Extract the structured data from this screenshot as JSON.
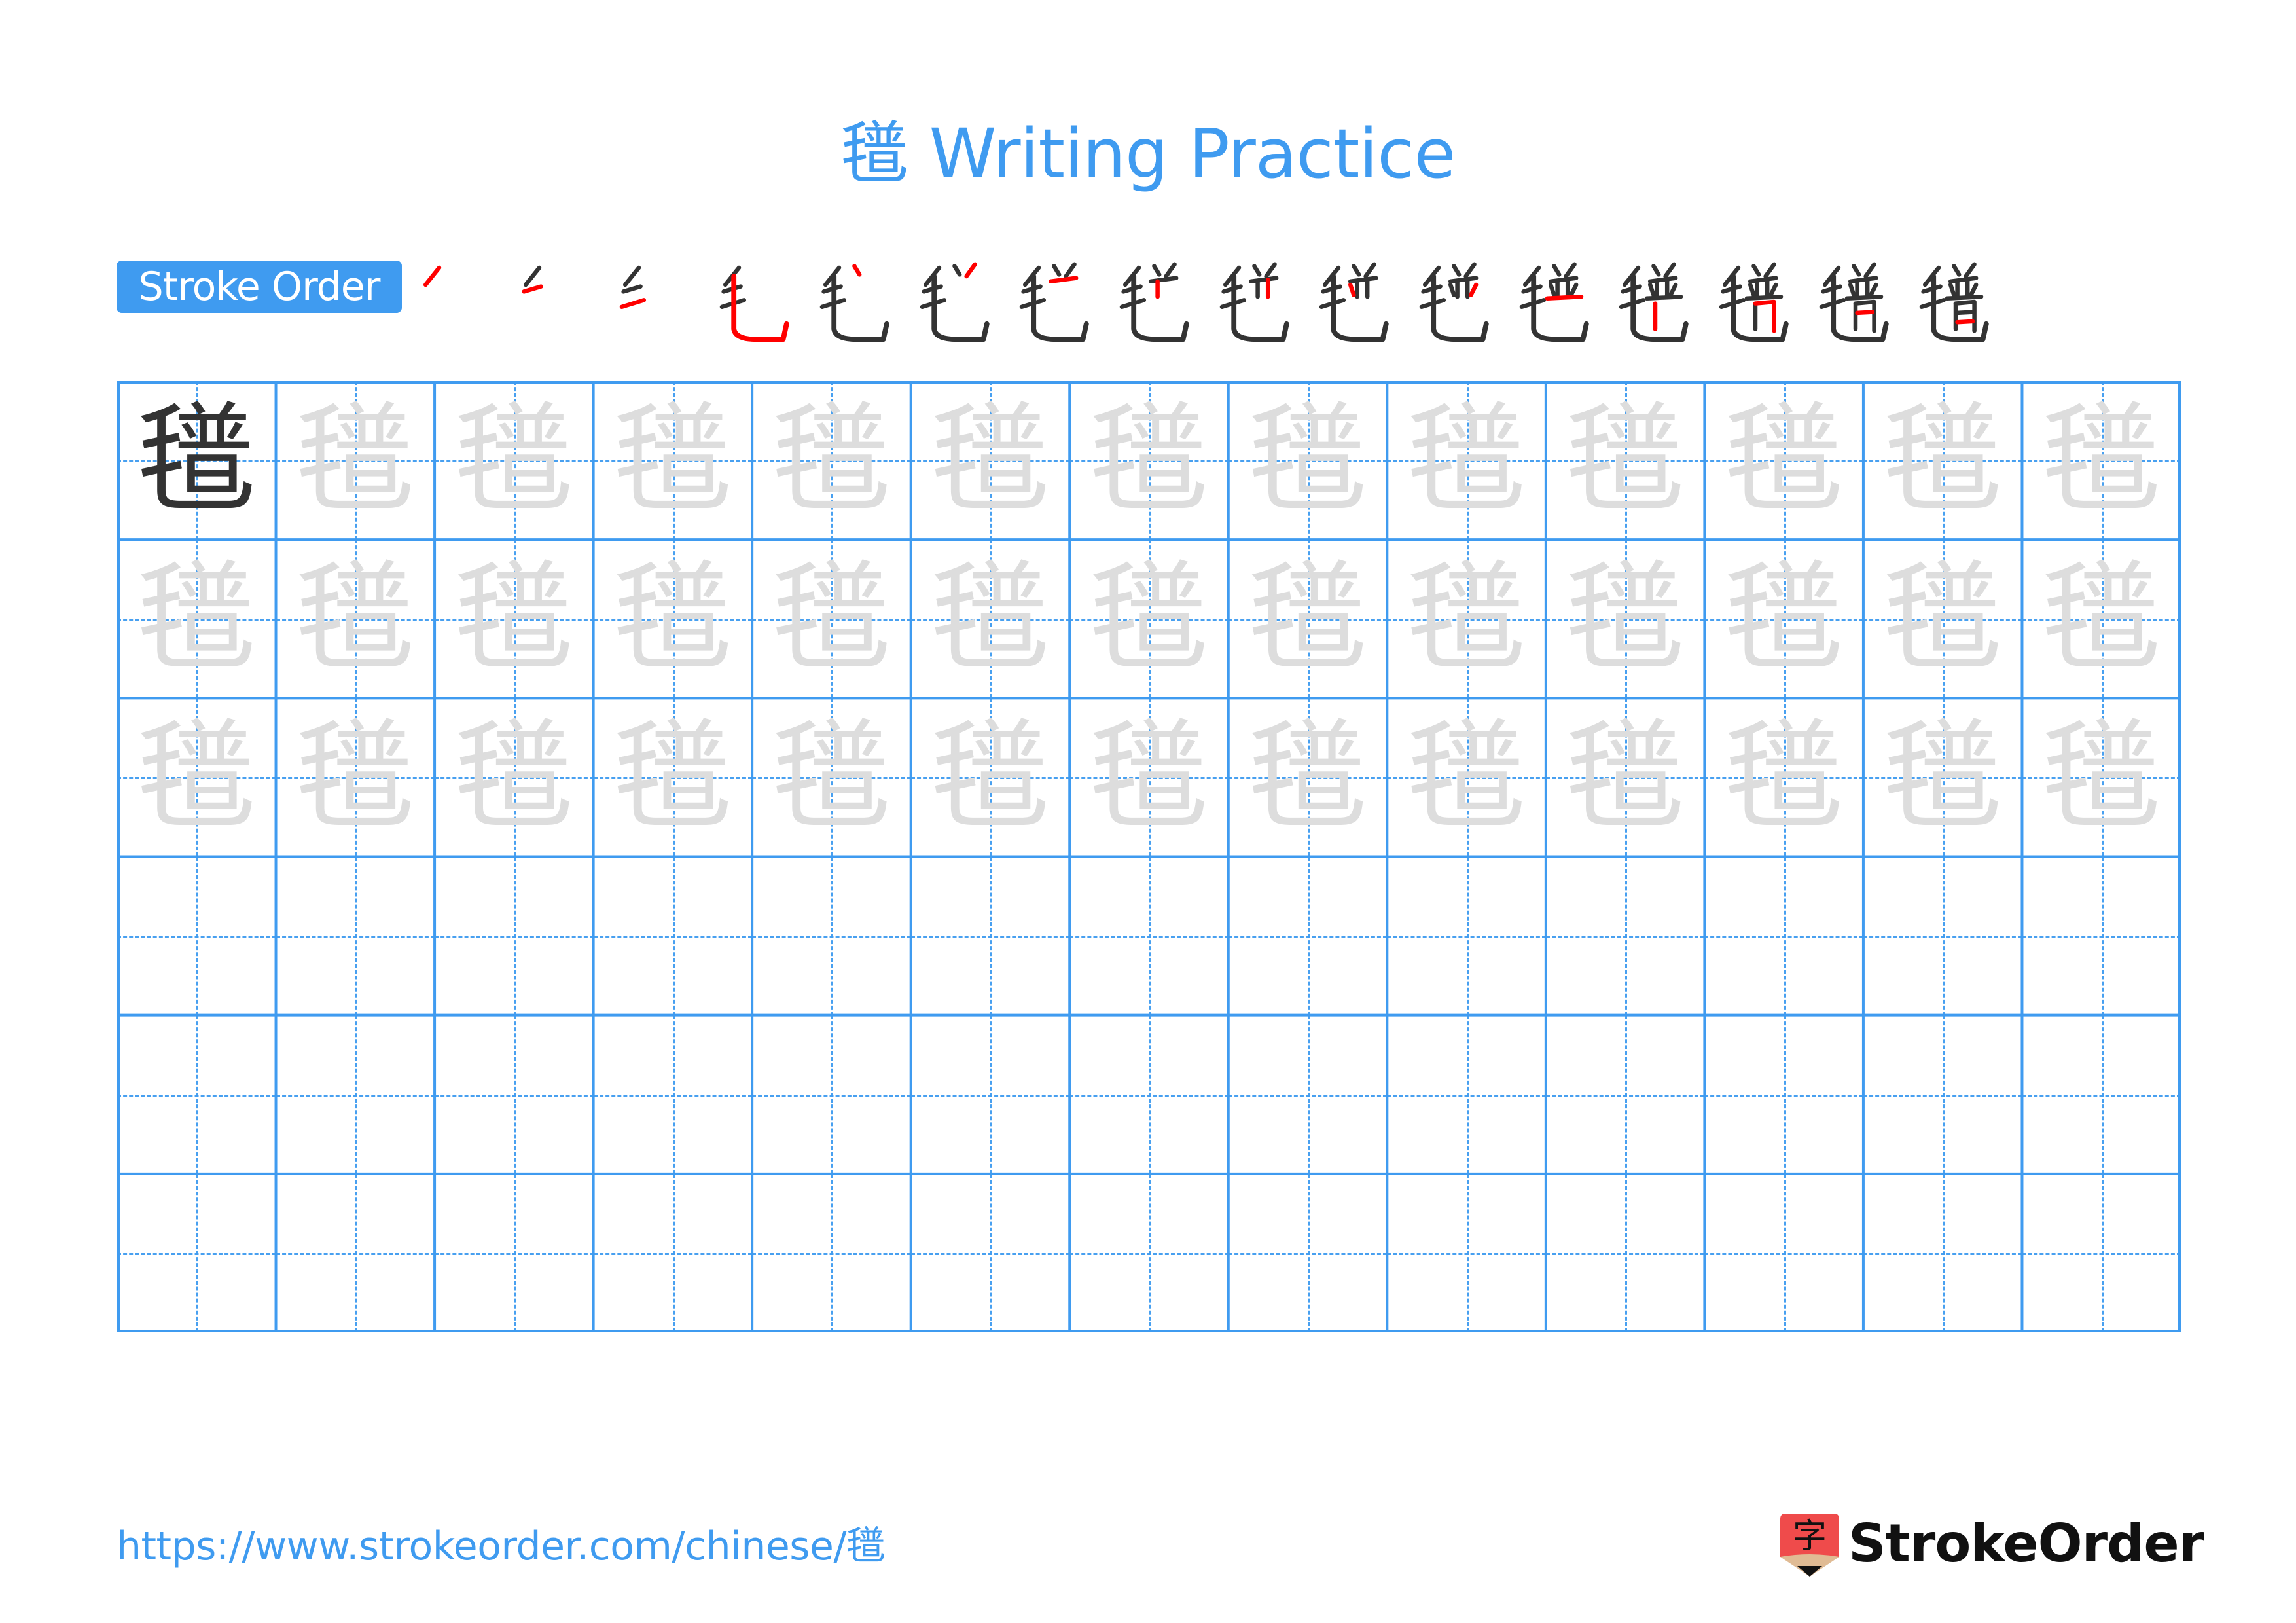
{
  "page": {
    "character": "氆",
    "title": "氆 Writing Practice",
    "stroke_order_label": "Stroke Order",
    "stroke_count": 16,
    "footer_url": "https://www.strokeorder.com/chinese/氆",
    "brand_name": "StrokeOrder",
    "brand_icon_glyph": "字"
  },
  "colors": {
    "accent": "#3f9bf0",
    "stroke_done": "#333333",
    "stroke_current": "#ff0000",
    "trace": "#dddddd",
    "brand_red": "#ef4b4b",
    "brand_wood": "#e0bb94"
  },
  "stroke_steps": [
    {
      "step": 1
    },
    {
      "step": 2
    },
    {
      "step": 3
    },
    {
      "step": 4
    },
    {
      "step": 5
    },
    {
      "step": 6
    },
    {
      "step": 7
    },
    {
      "step": 8
    },
    {
      "step": 9
    },
    {
      "step": 10
    },
    {
      "step": 11
    },
    {
      "step": 12
    },
    {
      "step": 13
    },
    {
      "step": 14
    },
    {
      "step": 15
    },
    {
      "step": 16
    }
  ],
  "grid": {
    "rows": 6,
    "cols": 13,
    "row_types": [
      "model-then-trace",
      "trace",
      "trace",
      "empty",
      "empty",
      "empty"
    ]
  }
}
